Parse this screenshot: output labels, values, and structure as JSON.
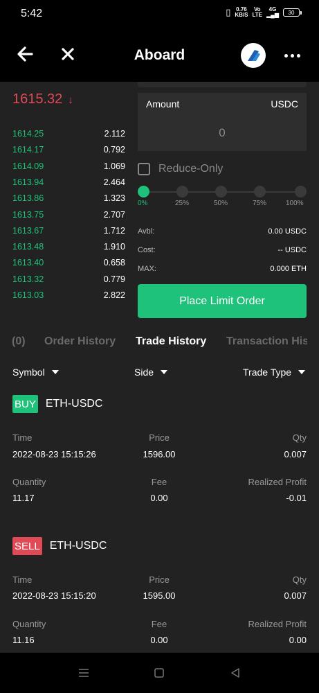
{
  "status_bar": {
    "time": "5:42",
    "net_speed": "0.76",
    "net_unit": "KB/S",
    "volte_top": "Vo",
    "volte_bottom": "LTE",
    "signal": "4G",
    "battery": "30"
  },
  "header": {
    "title": "Aboard",
    "back_icon": "arrow-left-icon",
    "close_icon": "close-icon",
    "logo_icon": "aboard-logo-icon",
    "more_icon": "more-horizontal-icon"
  },
  "orderbook": {
    "last_price": "1615.32",
    "direction": "↓",
    "rows": [
      {
        "price": "1614.25",
        "size": "2.112"
      },
      {
        "price": "1614.17",
        "size": "0.792"
      },
      {
        "price": "1614.09",
        "size": "1.069"
      },
      {
        "price": "1613.94",
        "size": "2.464"
      },
      {
        "price": "1613.86",
        "size": "1.323"
      },
      {
        "price": "1613.75",
        "size": "2.707"
      },
      {
        "price": "1613.67",
        "size": "1.712"
      },
      {
        "price": "1613.48",
        "size": "1.910"
      },
      {
        "price": "1613.40",
        "size": "0.658"
      },
      {
        "price": "1613.32",
        "size": "0.779"
      },
      {
        "price": "1613.03",
        "size": "2.822"
      }
    ]
  },
  "order_form": {
    "amount_label": "Amount",
    "amount_unit": "USDC",
    "amount_value": "0",
    "reduce_only_label": "Reduce-Only",
    "slider_percent": 0,
    "slider_labels": [
      "0%",
      "25%",
      "50%",
      "75%",
      "100%"
    ],
    "avbl_label": "Avbl:",
    "avbl_value": "0.00 USDC",
    "cost_label": "Cost:",
    "cost_value": "-- USDC",
    "max_label": "MAX:",
    "max_value": "0.000 ETH",
    "place_button": "Place Limit Order"
  },
  "tabs": {
    "open_orders": "(0)",
    "order_history": "Order History",
    "trade_history": "Trade History",
    "transaction_history": "Transaction His",
    "active": "trade_history"
  },
  "filters": {
    "symbol": "Symbol",
    "side": "Side",
    "trade_type": "Trade Type"
  },
  "trades": [
    {
      "side": "BUY",
      "symbol": "ETH-USDC",
      "time_label": "Time",
      "time": "2022-08-23 15:15:26",
      "price_label": "Price",
      "price": "1596.00",
      "qty_label": "Qty",
      "qty": "0.007",
      "quantity_label": "Quantity",
      "quantity": "11.17",
      "fee_label": "Fee",
      "fee": "0.00",
      "profit_label": "Realized Profit",
      "profit": "-0.01"
    },
    {
      "side": "SELL",
      "symbol": "ETH-USDC",
      "time_label": "Time",
      "time": "2022-08-23 15:15:20",
      "price_label": "Price",
      "price": "1595.00",
      "qty_label": "Qty",
      "qty": "0.007",
      "quantity_label": "Quantity",
      "quantity": "11.16",
      "fee_label": "Fee",
      "fee": "0.00",
      "profit_label": "Realized Profit",
      "profit": "0.00"
    }
  ],
  "colors": {
    "green": "#1fc27a",
    "red": "#e04a57",
    "panel": "#222222"
  }
}
